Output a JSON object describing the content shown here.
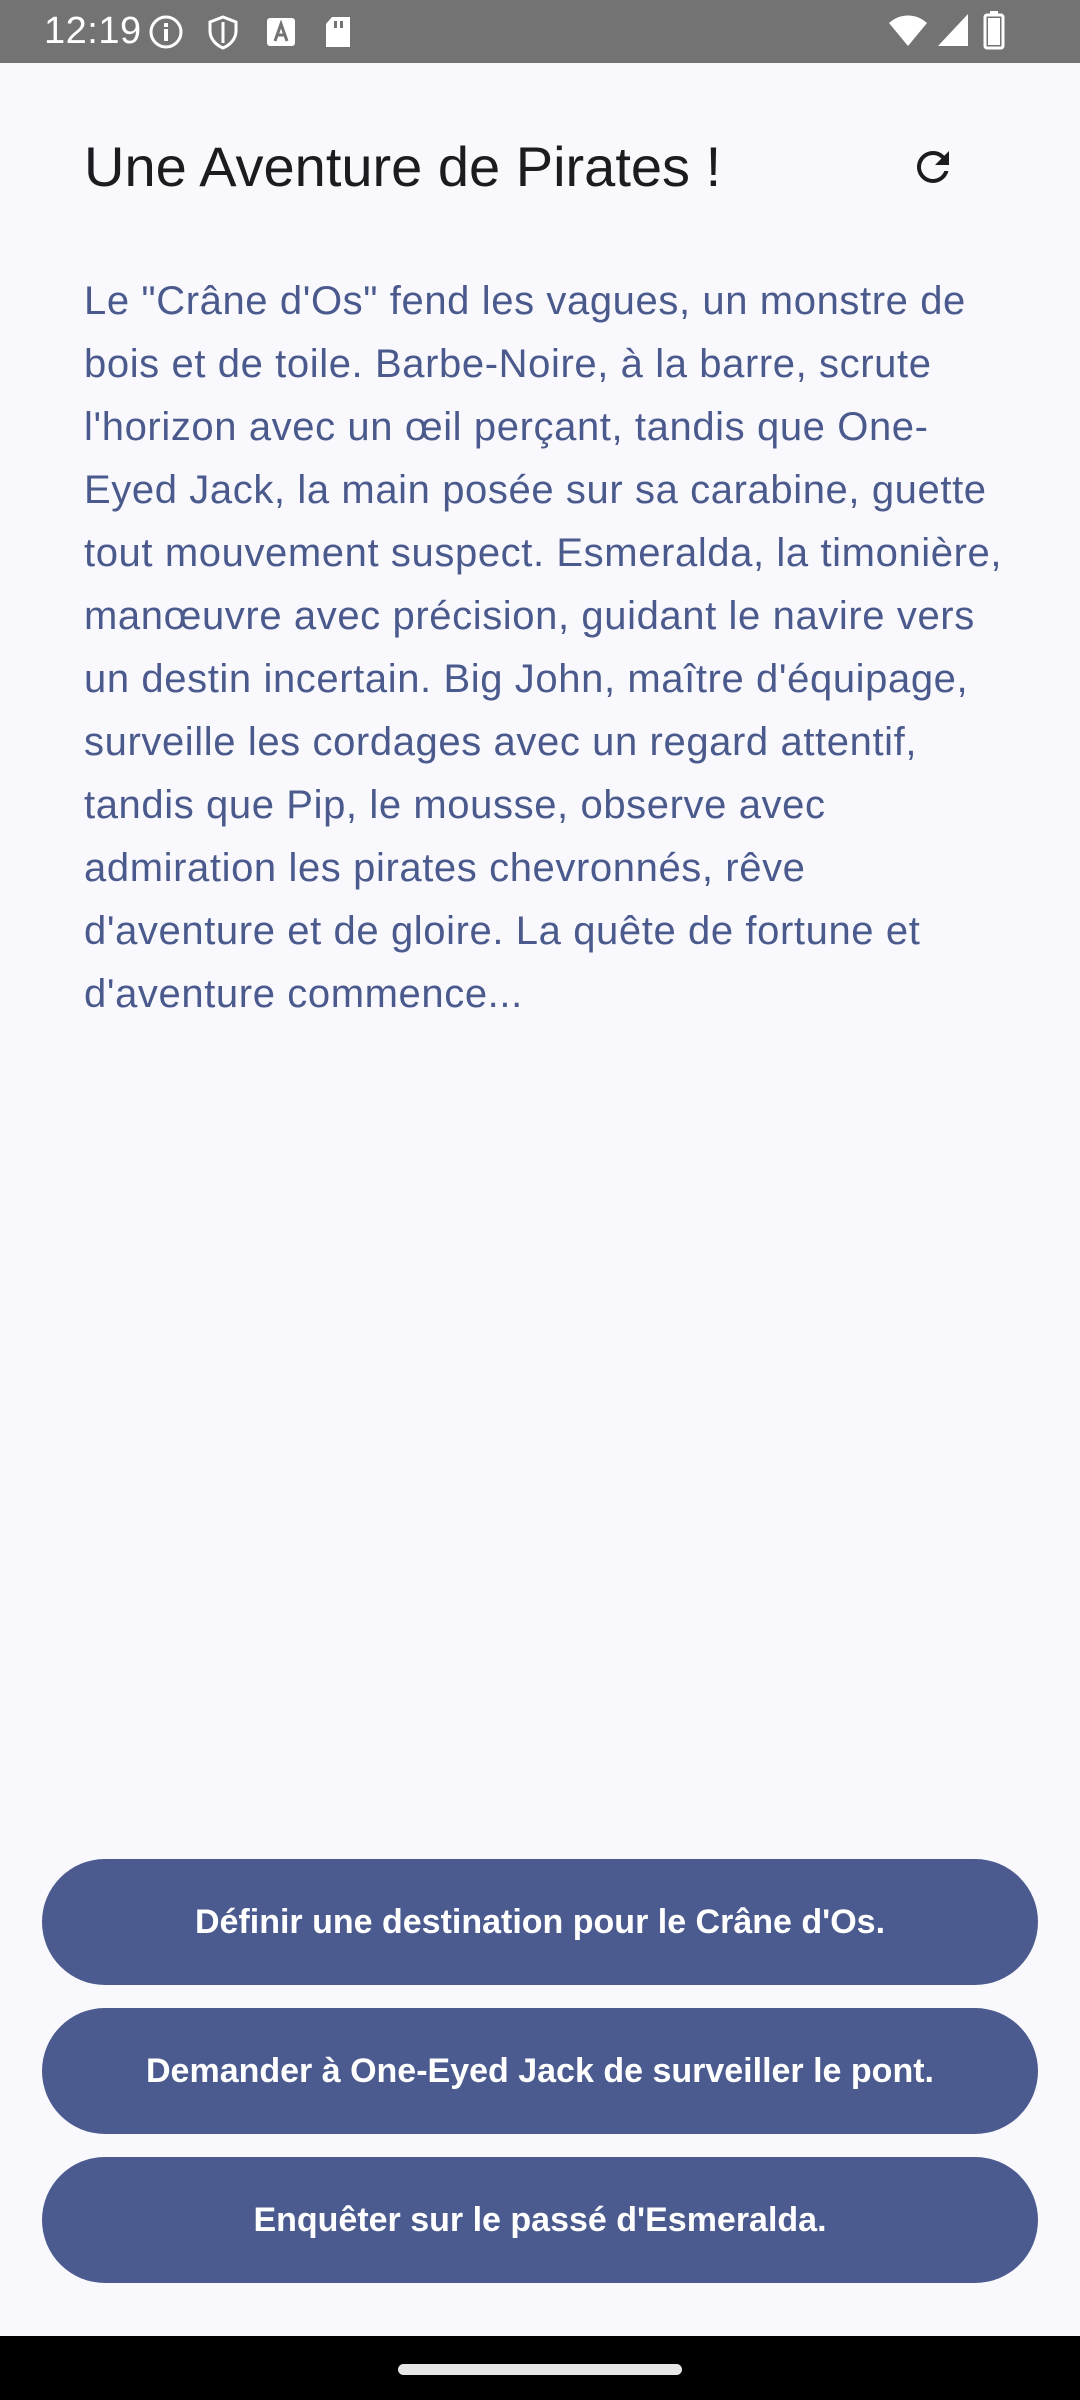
{
  "status_bar": {
    "time": "12:19",
    "left_icons": [
      "info-icon",
      "shield-icon",
      "app-a-icon",
      "sd-card-icon"
    ],
    "right_icons": [
      "wifi-icon",
      "signal-icon",
      "battery-icon"
    ]
  },
  "app_bar": {
    "title": "Une Aventure de Pirates !",
    "refresh_icon": "refresh-icon"
  },
  "story": {
    "text": "Le \"Crâne d'Os\" fend les vagues, un monstre de bois et de toile. Barbe-Noire, à la barre, scrute l'horizon avec un œil perçant, tandis que One-Eyed Jack, la main posée sur sa carabine, guette tout mouvement suspect. Esmeralda, la timonière, manœuvre avec précision, guidant le navire vers un destin incertain. Big John, maître d'équipage, surveille les cordages avec un regard attentif, tandis que Pip, le mousse, observe avec admiration les pirates chevronnés, rêve d'aventure et de gloire. La quête de fortune et d'aventure commence..."
  },
  "choices": [
    {
      "label": "Définir une destination pour le Crâne d'Os."
    },
    {
      "label": "Demander à One-Eyed Jack de surveiller le pont."
    },
    {
      "label": "Enquêter sur le passé d'Esmeralda."
    }
  ],
  "colors": {
    "background": "#f9f8fd",
    "status_bar": "#737373",
    "title_text": "#1c1b1f",
    "story_text": "#4a5a8c",
    "button_fill": "#4b5b8f",
    "button_text": "#ffffff"
  }
}
